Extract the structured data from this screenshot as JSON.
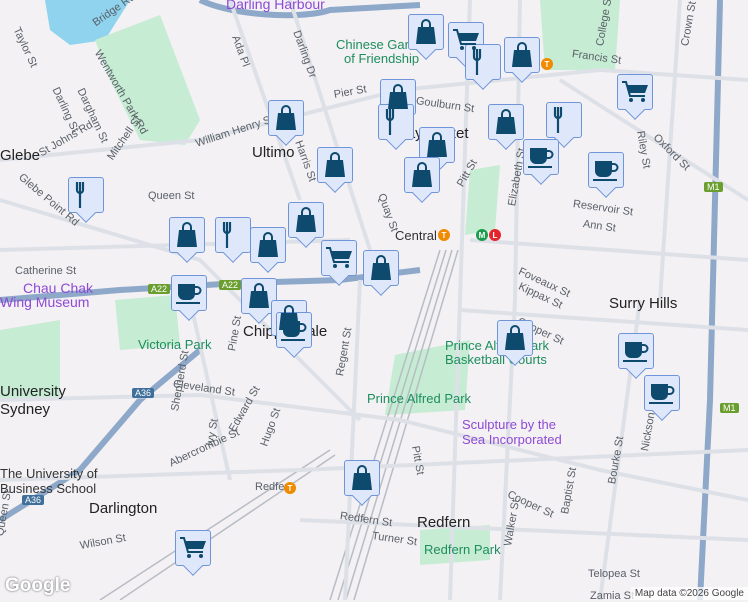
{
  "map": {
    "places": {
      "darling_harbour": "Darling Harbour",
      "chinese_garden": "Chinese Garden",
      "of_friendship": "of Friendship",
      "ultimo": "Ultimo",
      "glebe": "Glebe",
      "haymarket": "Haymarket",
      "central": "Central",
      "surry_hills": "Surry Hills",
      "chippendale": "Chippendale",
      "victoria_park": "Victoria Park",
      "university": "University",
      "sydney": "Sydney",
      "business_school_1": "The University of",
      "business_school_2": "Business School",
      "darlington": "Darlington",
      "redfern": "Redfern",
      "redfern_park": "Redfern Park",
      "prince_alfred_park": "Prince Alfred Park",
      "basketball_1": "Prince Alfred Park",
      "basketball_2": "Basketball Courts",
      "sculpture_1": "Sculpture by the",
      "sculpture_2": "Sea Incorporated",
      "chau_chak_1": "Chau Chak",
      "chau_chak_2": "Wing Museum",
      "redfern_station": "Redfern"
    },
    "streets": [
      "Bridge Rd",
      "Taylor St",
      "Wentworth Park Rd",
      "Darling St",
      "Dargham St",
      "Ada Pl",
      "Darling Dr",
      "Pier St",
      "Goulburn St",
      "William Henry St",
      "Harris St",
      "St Johns Rd",
      "Mitchell St",
      "Glebe Point Rd",
      "Queen St",
      "Catherine St",
      "Quay St",
      "Pitt St",
      "Elizabeth St",
      "College St",
      "Francis St",
      "Crown St",
      "Oxford St",
      "Riley St",
      "Reservoir St",
      "Ann St",
      "Foveaux St",
      "Kippax St",
      "Cooper St",
      "Regent St",
      "Cleveland St",
      "Pine St",
      "Shepherd St",
      "Edward St",
      "Ivy St",
      "Hugo St",
      "Abercrombie St",
      "Wilson St",
      "Turner St",
      "Redfern St",
      "Walker St",
      "Baptist St",
      "Nickson St",
      "Bourke St",
      "Telopea St",
      "Zamia St",
      "Queen St",
      "Cooper St",
      "Pitt St"
    ],
    "road_shields": [
      "A22",
      "A22",
      "A36",
      "A36",
      "M1",
      "M1"
    ],
    "attribution": "Map data ©2026 Google",
    "google_logo": "Google",
    "markers": [
      {
        "type": "shopping"
      },
      {
        "type": "grocery"
      },
      {
        "type": "restaurant"
      },
      {
        "type": "shopping"
      },
      {
        "type": "shopping"
      },
      {
        "type": "restaurant"
      },
      {
        "type": "shopping"
      },
      {
        "type": "shopping"
      },
      {
        "type": "restaurant"
      },
      {
        "type": "shopping"
      },
      {
        "type": "shopping"
      },
      {
        "type": "shopping"
      },
      {
        "type": "cafe"
      },
      {
        "type": "cafe"
      },
      {
        "type": "grocery"
      },
      {
        "type": "restaurant"
      },
      {
        "type": "shopping"
      },
      {
        "type": "restaurant"
      },
      {
        "type": "shopping"
      },
      {
        "type": "shopping"
      },
      {
        "type": "grocery"
      },
      {
        "type": "shopping"
      },
      {
        "type": "cafe"
      },
      {
        "type": "shopping"
      },
      {
        "type": "shopping"
      },
      {
        "type": "cafe"
      },
      {
        "type": "shopping"
      },
      {
        "type": "cafe"
      },
      {
        "type": "cafe"
      },
      {
        "type": "shopping"
      },
      {
        "type": "grocery"
      }
    ],
    "colors": {
      "marker_icon": "#0d4a6e",
      "marker_bg": "#dfe8fb",
      "park": "#c6ecd4",
      "water": "#8fd3ee",
      "highway": "#8ea8c9"
    }
  }
}
